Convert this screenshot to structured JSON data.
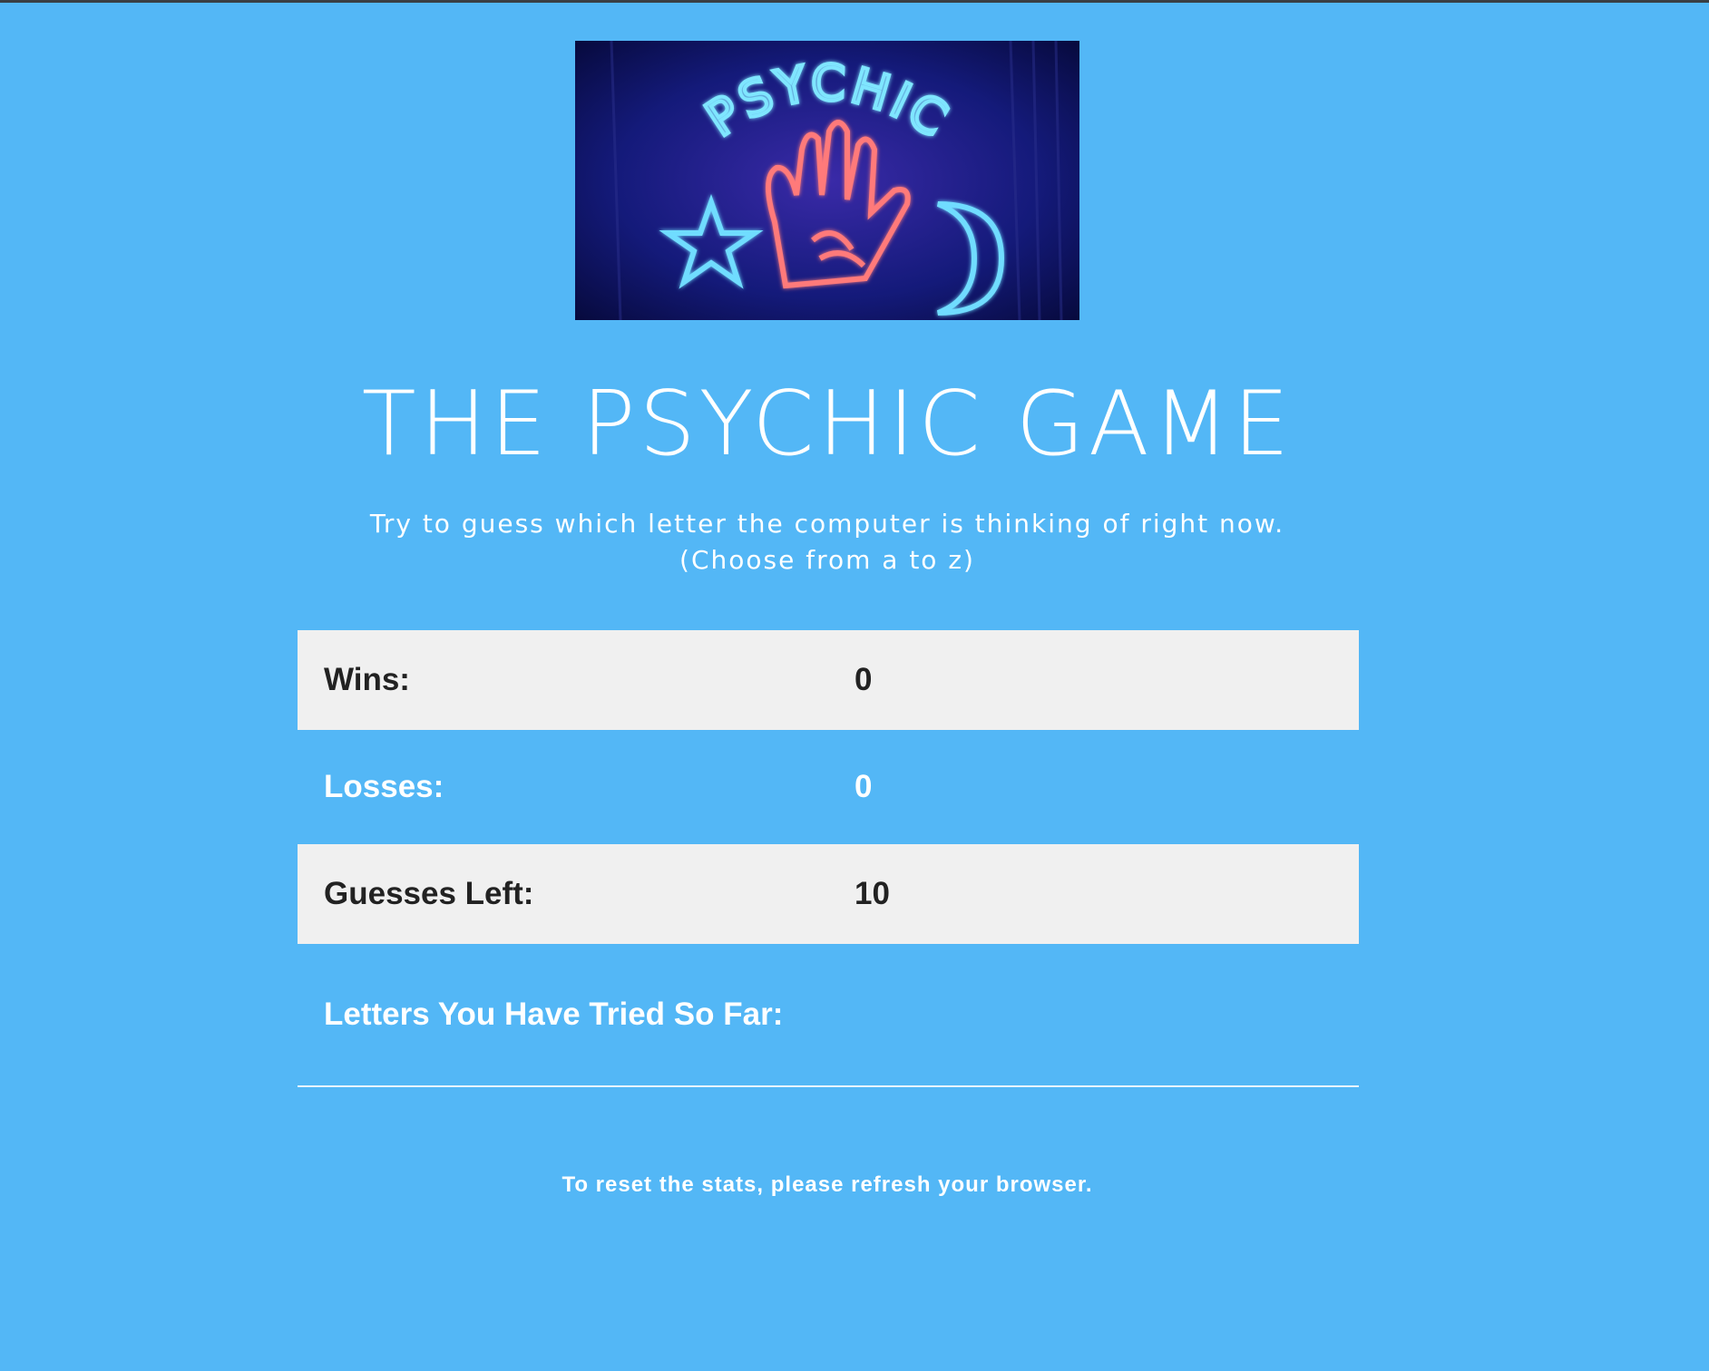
{
  "hero": {
    "sign_text": "PSYCHIC",
    "alt": "neon psychic sign"
  },
  "header": {
    "title": "THE PSYCHIC GAME",
    "subtitle_line1": "Try to guess which letter the computer is thinking of right now.",
    "subtitle_line2": "(Choose from a to z)"
  },
  "stats": {
    "wins_label": "Wins:",
    "wins_value": "0",
    "losses_label": "Losses:",
    "losses_value": "0",
    "guesses_label": "Guesses Left:",
    "guesses_value": "10",
    "tried_label": "Letters You Have Tried So Far:",
    "tried_value": ""
  },
  "footer": {
    "note": "To reset the stats, please refresh your browser."
  },
  "colors": {
    "background": "#53b7f6",
    "row_shade": "#f0f0f0",
    "neon_blue": "#5fd8ff",
    "neon_red": "#ff6b6b"
  }
}
